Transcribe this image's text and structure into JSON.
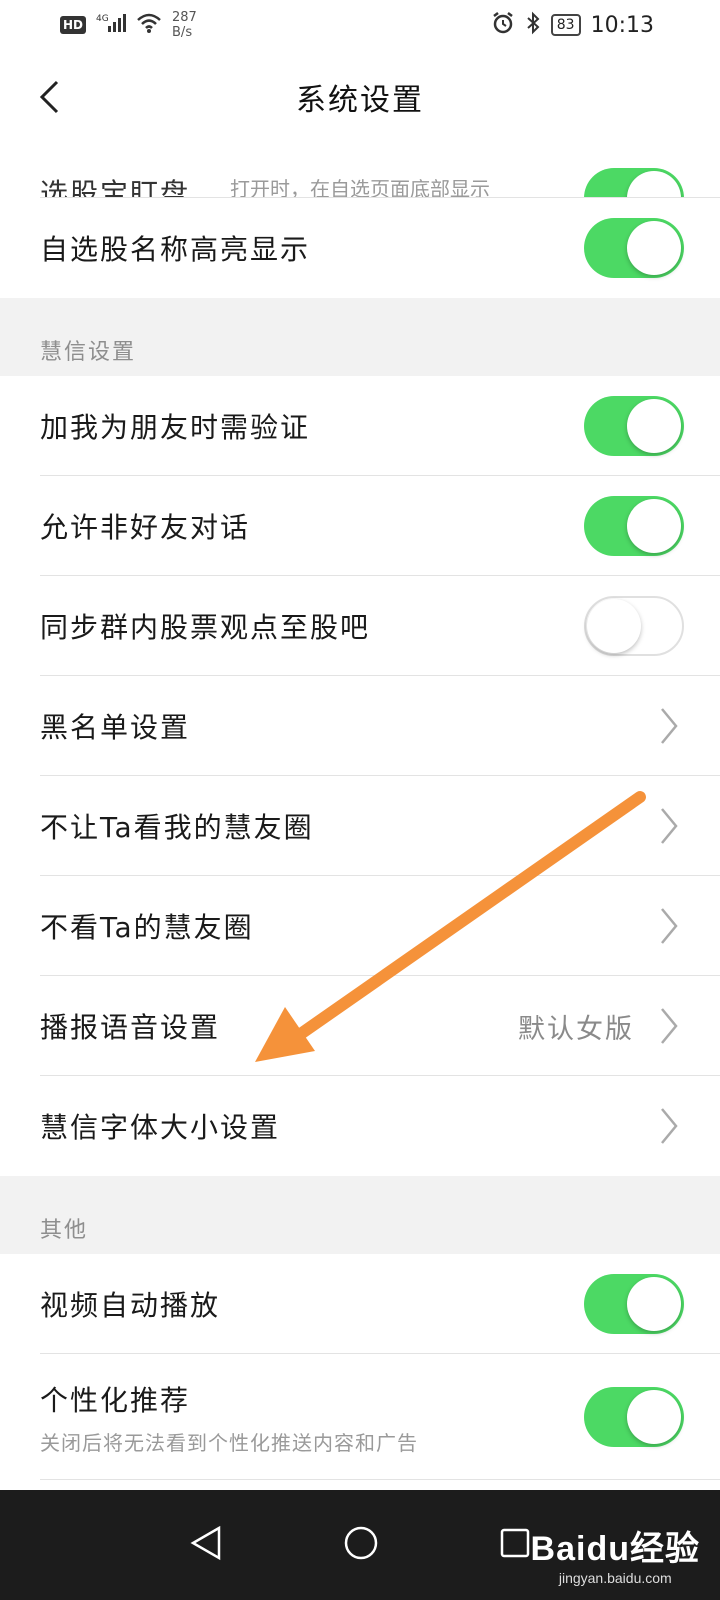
{
  "status_bar": {
    "hd": "HD",
    "network": "4G",
    "speed_value": "287",
    "speed_unit": "B/s",
    "battery": "83",
    "time": "10:13"
  },
  "header": {
    "title": "系统设置"
  },
  "partial_row": {
    "label": "选股宝盯盘",
    "hint": "打开时，在自选页面底部显示",
    "toggle_on": true
  },
  "rows_top": [
    {
      "label": "自选股名称高亮显示",
      "toggle_on": true
    }
  ],
  "section_huixin": {
    "title": "慧信设置",
    "rows": [
      {
        "label": "加我为朋友时需验证",
        "type": "toggle",
        "toggle_on": true
      },
      {
        "label": "允许非好友对话",
        "type": "toggle",
        "toggle_on": true
      },
      {
        "label": "同步群内股票观点至股吧",
        "type": "toggle",
        "toggle_on": false
      },
      {
        "label": "黑名单设置",
        "type": "link"
      },
      {
        "label": "不让Ta看我的慧友圈",
        "type": "link"
      },
      {
        "label": "不看Ta的慧友圈",
        "type": "link"
      },
      {
        "label": "播报语音设置",
        "type": "link",
        "value": "默认女版"
      },
      {
        "label": "慧信字体大小设置",
        "type": "link"
      }
    ]
  },
  "section_other": {
    "title": "其他",
    "rows": [
      {
        "label": "视频自动播放",
        "toggle_on": true
      },
      {
        "label": "个性化推荐",
        "sublabel": "关闭后将无法看到个性化推送内容和广告",
        "toggle_on": true
      }
    ]
  },
  "watermark": {
    "main": "Baidu经验",
    "sub": "jingyan.baidu.com"
  },
  "colors": {
    "toggle_on": "#4cd964",
    "arrow": "#f5923a",
    "section_bg": "#f2f2f2"
  }
}
